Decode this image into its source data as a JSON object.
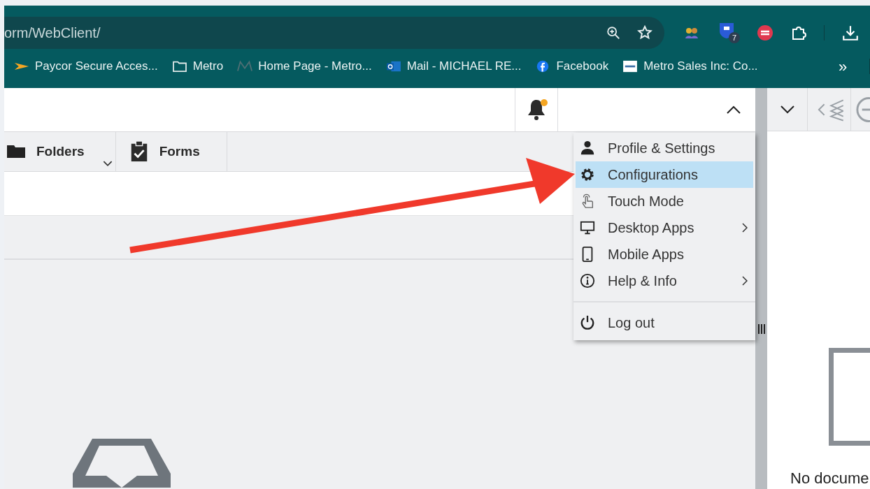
{
  "browser": {
    "address": "orm/WebClient/",
    "extension_badge": "7",
    "bookmarks": [
      {
        "kind": "paycor",
        "label": "Paycor Secure Acces..."
      },
      {
        "kind": "folder",
        "label": "Metro"
      },
      {
        "kind": "metro",
        "label": "Home Page - Metro..."
      },
      {
        "kind": "outlook",
        "label": "Mail - MICHAEL RE..."
      },
      {
        "kind": "facebook",
        "label": "Facebook"
      },
      {
        "kind": "msi",
        "label": "Metro Sales Inc: Co..."
      }
    ],
    "more_bookmarks": "»"
  },
  "app": {
    "bell": {
      "alert": true
    },
    "tabs": [
      {
        "kind": "folders",
        "label": "Folders",
        "dropdown": true,
        "selected": false
      },
      {
        "kind": "forms",
        "label": "Forms",
        "dropdown": false,
        "selected": false
      }
    ]
  },
  "user_menu": {
    "items": [
      {
        "kind": "profile",
        "label": "Profile & Settings",
        "submenu": false,
        "selected": false
      },
      {
        "kind": "settings",
        "label": "Configurations",
        "submenu": false,
        "selected": true
      },
      {
        "kind": "touch",
        "label": "Touch Mode",
        "submenu": false,
        "selected": false
      },
      {
        "kind": "desktop",
        "label": "Desktop Apps",
        "submenu": true,
        "selected": false
      },
      {
        "kind": "mobile",
        "label": "Mobile Apps",
        "submenu": false,
        "selected": false
      },
      {
        "kind": "info",
        "label": "Help & Info",
        "submenu": true,
        "selected": false
      }
    ],
    "footer_items": [
      {
        "kind": "power",
        "label": "Log out",
        "submenu": false,
        "selected": false
      }
    ]
  },
  "preview_panel": {
    "empty_text": "No docume"
  }
}
